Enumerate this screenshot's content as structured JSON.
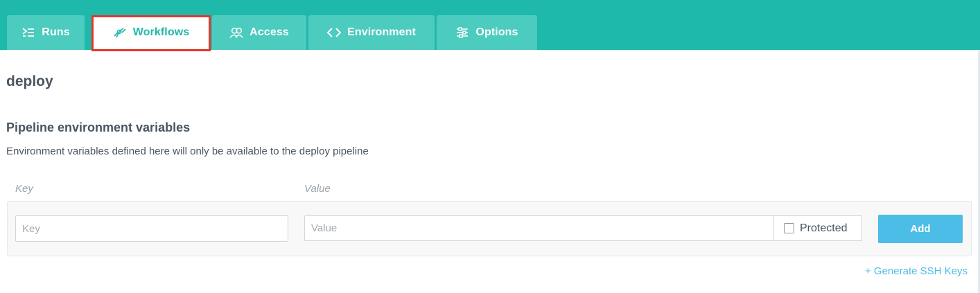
{
  "tabs": [
    {
      "label": "Runs",
      "icon": "runs-icon"
    },
    {
      "label": "Workflows",
      "icon": "workflow-icon",
      "active": true
    },
    {
      "label": "Access",
      "icon": "users-icon"
    },
    {
      "label": "Environment",
      "icon": "code-brackets-icon"
    },
    {
      "label": "Options",
      "icon": "sliders-icon"
    }
  ],
  "page": {
    "title": "deploy"
  },
  "env_section": {
    "title": "Pipeline environment variables",
    "description": "Environment variables defined here will only be available to the deploy pipeline",
    "key_column": "Key",
    "value_column": "Value",
    "key_placeholder": "Key",
    "value_placeholder": "Value",
    "protected_label": "Protected",
    "protected_checked": false,
    "add_label": "Add"
  },
  "ssh_link": "+ Generate SSH Keys",
  "colors": {
    "header": "#1fb9ab",
    "tab": "#4ccbbf",
    "active_tab_text": "#1fb9ab",
    "highlight": "#e8352b",
    "button": "#4bbde6"
  }
}
